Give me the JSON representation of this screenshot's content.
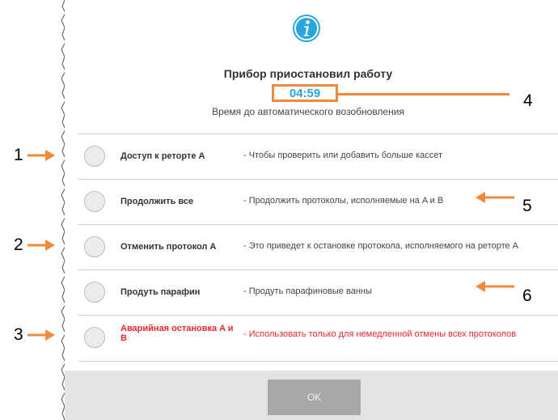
{
  "dialog": {
    "title": "Прибор приостановил работу",
    "timer": "04:59",
    "subtitle": "Время до автоматического возобновления",
    "options": [
      {
        "label": "Доступ к реторте A",
        "desc": "- Чтобы проверить или добавить больше кассет"
      },
      {
        "label": "Продолжить все",
        "desc": "- Продолжить протоколы, исполняемые на A и B"
      },
      {
        "label": "Отменить протокол A",
        "desc": "- Это приведет к остановке протокола, исполняемого на реторте A"
      },
      {
        "label": "Продуть парафин",
        "desc": "- Продуть парафиновые ванны"
      },
      {
        "label": "Аварийная остановка A и B",
        "desc": "- Использовать только для немедленной отмены всех протоколов"
      }
    ],
    "ok_label": "OK"
  },
  "callouts": [
    "1",
    "2",
    "3",
    "4",
    "5",
    "6"
  ],
  "colors": {
    "accent": "#ef8a3d",
    "timer": "#2aa6de",
    "emergency": "#e8282b",
    "info_icon": "#2aa6de"
  }
}
